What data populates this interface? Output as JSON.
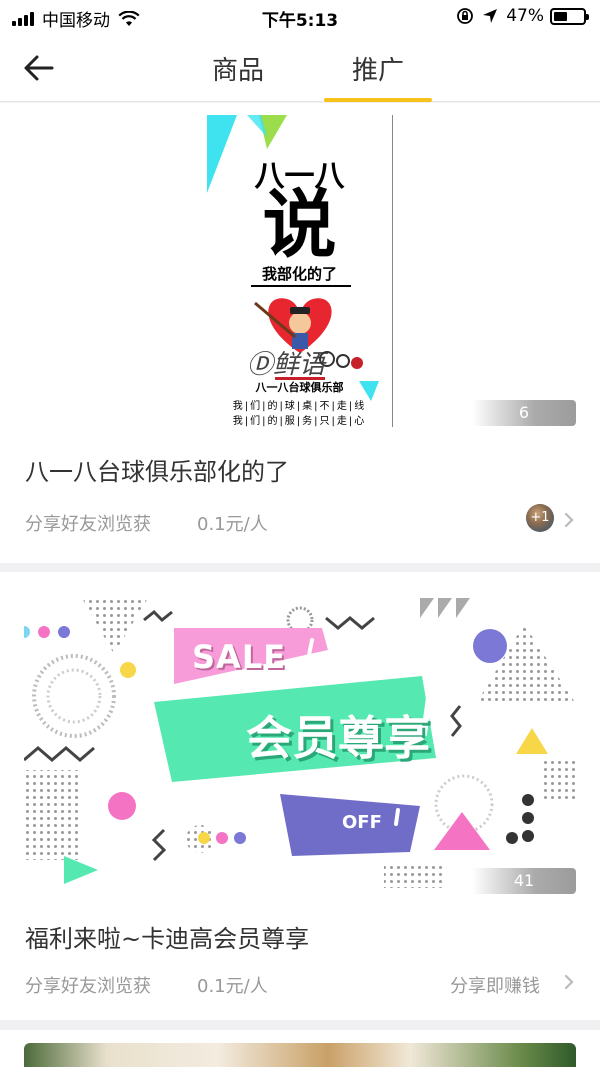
{
  "status_bar": {
    "carrier": "中国移动",
    "time": "下午5:13",
    "battery": "47%",
    "battery_level": 0.47
  },
  "nav": {
    "tabs": [
      "商品",
      "推广"
    ],
    "active_tab": "推广"
  },
  "cards": [
    {
      "poster": {
        "title": "八一八",
        "big_text": "说",
        "sub": "我部化的了",
        "club": "八一八台球俱乐部",
        "slogan_1": "我|们|的|球|桌|不|走|线",
        "slogan_2": "我|们|的|服|务|只|走|心"
      },
      "count": "6",
      "title": "八一八台球俱乐部化的了",
      "share_text": "分享好友浏览获",
      "price": "0.1元/人",
      "avatar_label": "+1"
    },
    {
      "banner": {
        "sale": "SALE",
        "main": "会员尊享",
        "off": "OFF"
      },
      "count": "41",
      "title": "福利来啦~卡迪高会员尊享",
      "share_text": "分享好友浏览获",
      "price": "0.1元/人",
      "action": "分享即赚钱"
    }
  ],
  "colors": {
    "accent": "#f6c21a",
    "text": "#333333",
    "muted": "#999999",
    "background": "#f0f0f3"
  }
}
